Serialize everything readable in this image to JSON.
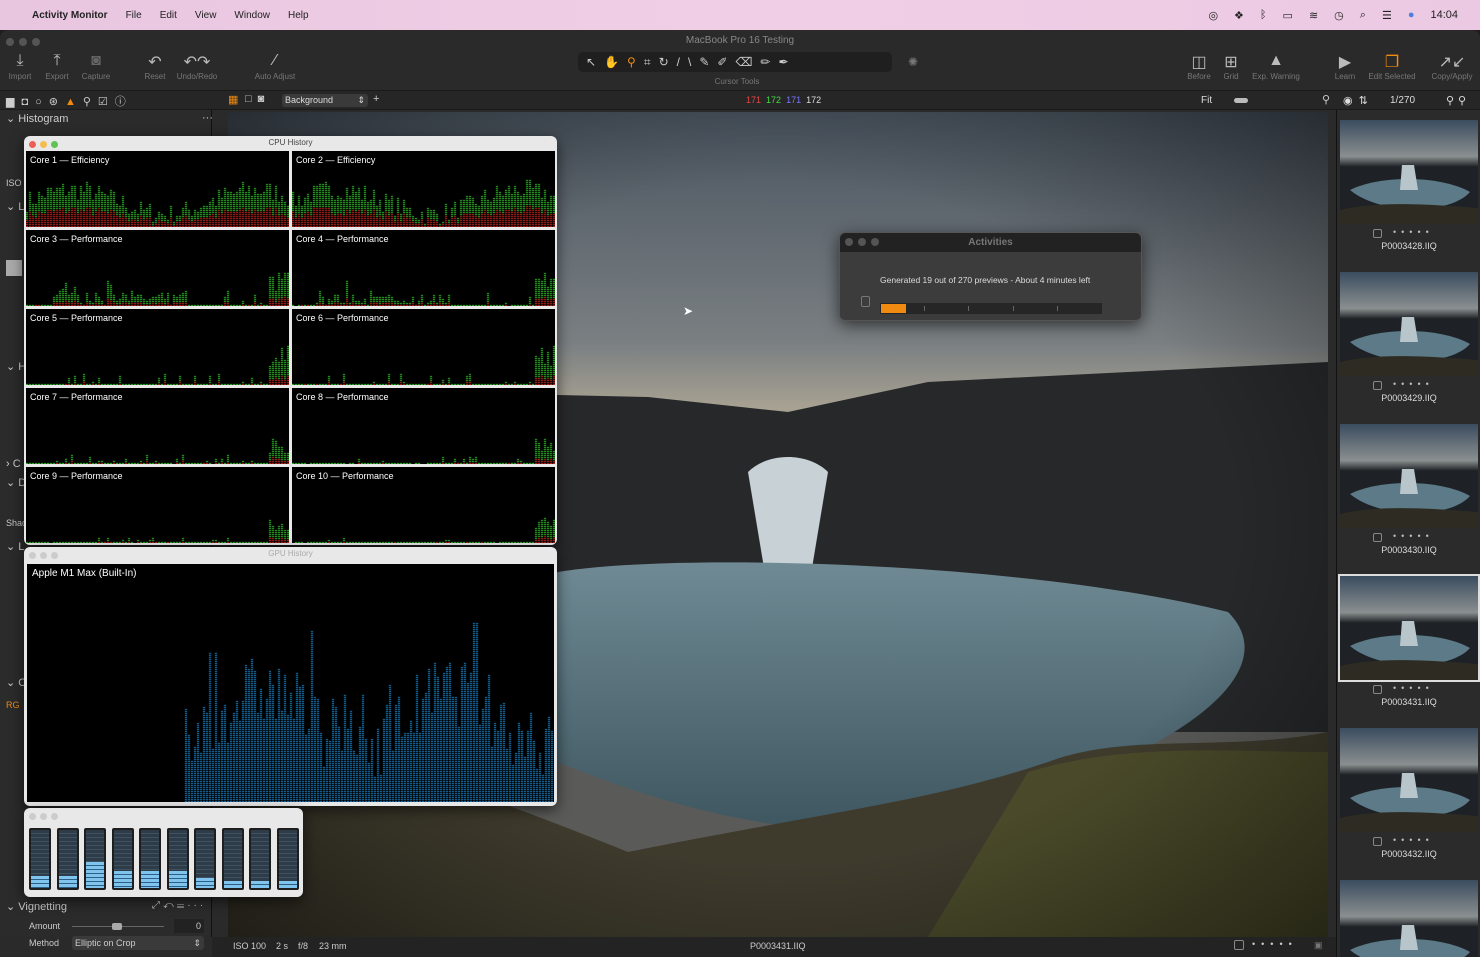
{
  "menubar": {
    "app": "Activity Monitor",
    "items": [
      "File",
      "Edit",
      "View",
      "Window",
      "Help"
    ],
    "clock": "14:04",
    "tray_icons": [
      "creative-cloud-icon",
      "dropbox-icon",
      "bluetooth-icon",
      "battery-icon",
      "wifi-icon",
      "time-machine-icon",
      "spotlight-icon",
      "control-center-icon",
      "siri-icon"
    ]
  },
  "window": {
    "title": "MacBook Pro 16 Testing"
  },
  "toolbar": {
    "left": [
      {
        "label": "Import",
        "icon": "import-icon"
      },
      {
        "label": "Export",
        "icon": "export-icon"
      },
      {
        "label": "Capture",
        "icon": "camera-icon"
      },
      {
        "label": "Reset",
        "icon": "reset-icon"
      },
      {
        "label": "Undo/Redo",
        "icon": "undo-redo-icon"
      },
      {
        "label": "Auto Adjust",
        "icon": "magic-wand-icon"
      }
    ],
    "cursor_tools_label": "Cursor Tools",
    "right": [
      {
        "label": "Before",
        "icon": "before-icon"
      },
      {
        "label": "Grid",
        "icon": "grid-icon"
      },
      {
        "label": "Exp. Warning",
        "icon": "warning-icon"
      },
      {
        "label": "Learn",
        "icon": "learn-icon"
      },
      {
        "label": "Edit Selected",
        "icon": "edit-selected-icon"
      },
      {
        "label": "Copy/Apply",
        "icon": "copy-apply-icon"
      }
    ]
  },
  "row2": {
    "layer": "Background",
    "rgb": {
      "r": "171",
      "g": "172",
      "b": "171",
      "l": "172"
    },
    "zoom": "Fit",
    "counter": "1/270"
  },
  "left_panel": {
    "histogram": "Histogram",
    "iso": "ISO",
    "vignetting": "Vignetting",
    "amount_label": "Amount",
    "amount_value": "0",
    "method_label": "Method",
    "method_value": "Elliptic on Crop",
    "shad": "Shad",
    "rgb_tab": "RG"
  },
  "cpu_history": {
    "title": "CPU History",
    "cores": [
      "Core 1 — Efficiency",
      "Core 2 — Efficiency",
      "Core 3 — Performance",
      "Core 4 — Performance",
      "Core 5 — Performance",
      "Core 6 — Performance",
      "Core 7 — Performance",
      "Core 8 — Performance",
      "Core 9 — Performance",
      "Core 10 — Performance"
    ]
  },
  "gpu_history": {
    "title": "GPU History",
    "gpu": "Apple M1 Max (Built-In)"
  },
  "cpu_meter": {
    "levels": [
      0.2,
      0.2,
      0.45,
      0.3,
      0.3,
      0.3,
      0.18,
      0.12,
      0.12,
      0.12
    ]
  },
  "activities": {
    "title": "Activities",
    "message": "Generated 19 out of 270 previews - About 4 minutes left",
    "done": 19,
    "total": 270,
    "accent": "#f08a10"
  },
  "info": {
    "iso": "ISO 100",
    "shutter": "2 s",
    "aperture": "f/8",
    "focal": "23 mm",
    "filename": "P0003431.IIQ"
  },
  "filmstrip": [
    {
      "name": "P0003428.IIQ"
    },
    {
      "name": "P0003429.IIQ"
    },
    {
      "name": "P0003430.IIQ"
    },
    {
      "name": "P0003431.IIQ",
      "selected": true
    },
    {
      "name": "P0003432.IIQ"
    },
    {
      "name": ""
    }
  ]
}
